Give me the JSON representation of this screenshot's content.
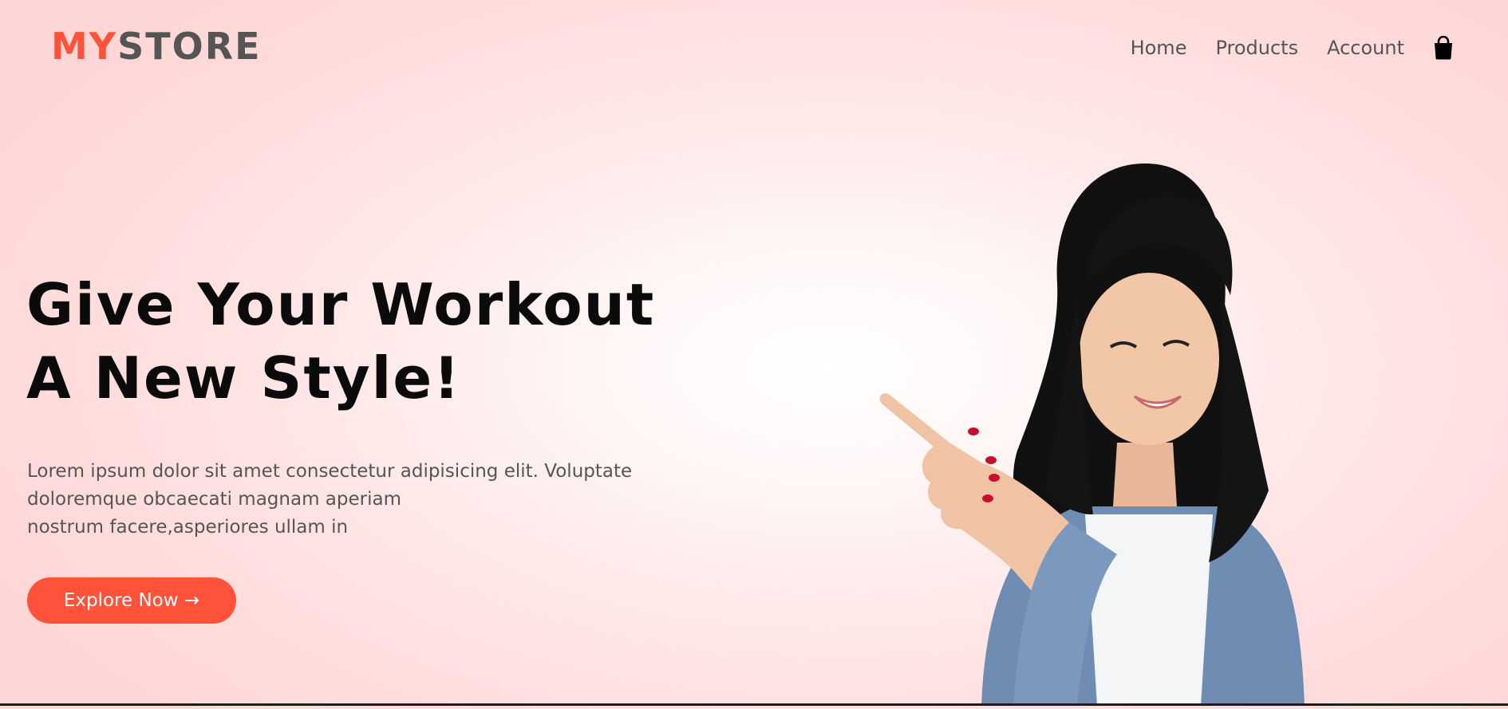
{
  "logo": {
    "part_a": "MY",
    "part_b": "STORE"
  },
  "nav": {
    "items": [
      {
        "label": "Home"
      },
      {
        "label": "Products"
      },
      {
        "label": "Account"
      }
    ],
    "cart_icon": "shopping-bag-icon"
  },
  "hero": {
    "title_line1": "Give Your Workout",
    "title_line2": "A New Style!",
    "text_line1": "Lorem ipsum dolor sit amet consectetur adipisicing elit. Voluptate",
    "text_line2": "doloremque obcaecati magnam aperiam",
    "text_line3": "nostrum facere,asperiores ullam in",
    "button_label": "Explore Now →"
  },
  "colors": {
    "accent": "#ff523b",
    "text_dark": "#0b0b0b",
    "text_muted": "#555555",
    "background": "#ffe3e3"
  }
}
